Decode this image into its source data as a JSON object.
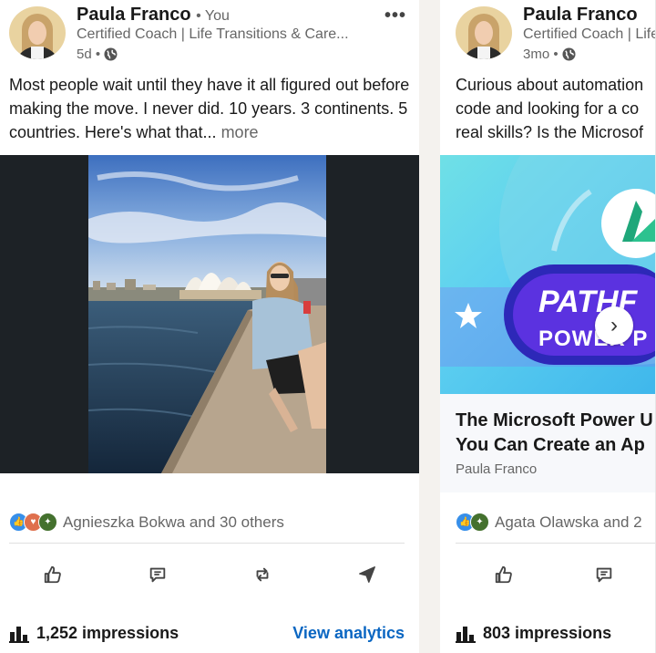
{
  "colors": {
    "link": "#0a66c2",
    "text": "#191919",
    "muted": "#666666"
  },
  "posts": [
    {
      "author": "Paula Franco",
      "you_label": "• You",
      "headline": "Certified Coach | Life Transitions & Care...",
      "time": "5d •",
      "text": "Most people wait until they have it all figured out before making the move. I never did. 10 years. 3 continents. 5 countries. Here's what that...",
      "more": "more",
      "reactions_text": "Agnieszka Bokwa and 30 others",
      "impressions": "1,252 impressions",
      "analytics_link": "View analytics",
      "icons": [
        "like-icon",
        "comment-icon",
        "repost-icon",
        "send-icon"
      ]
    },
    {
      "author": "Paula Franco",
      "headline": "Certified Coach | Life Transitions & Care...",
      "time": "3mo •",
      "text": "Curious about automation... code and looking for a co... real skills? Is the Microsof...",
      "text_lines": [
        "Curious about automation",
        "code and looking for a co",
        "real skills? Is the Microsof"
      ],
      "banner_word_1": "PATHF",
      "banner_word_2": "POWER P",
      "article_title": "The Microsoft Power U... You Can Create an Ap...",
      "article_title_lines": [
        "The Microsoft Power U",
        "You Can Create an Ap"
      ],
      "article_author": "Paula Franco",
      "reactions_text": "Agata Olawska and 2",
      "impressions": "803 impressions"
    }
  ]
}
